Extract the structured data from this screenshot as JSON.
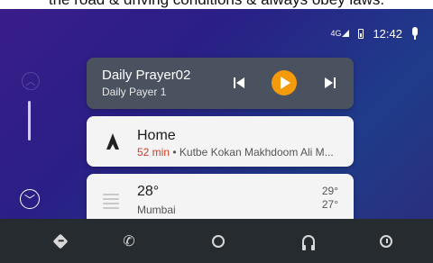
{
  "top_banner": {
    "text": "the road & driving conditions & always obey laws."
  },
  "status_bar": {
    "network": "4G",
    "time": "12:42"
  },
  "media_card": {
    "title": "Daily Prayer02",
    "subtitle": "Daily Payer 1",
    "accent_color": "#f59a0b"
  },
  "nav_card": {
    "destination": "Home",
    "eta": "52 min",
    "separator": " • ",
    "route": "Kutbe Kokan Makhdoom Ali M..."
  },
  "weather_card": {
    "temp": "28°",
    "city": "Mumbai",
    "high": "29°",
    "low": "27°"
  },
  "bottom_nav": {
    "items": [
      "directions-icon",
      "phone-icon",
      "home-icon",
      "headphones-icon",
      "recents-icon"
    ]
  }
}
